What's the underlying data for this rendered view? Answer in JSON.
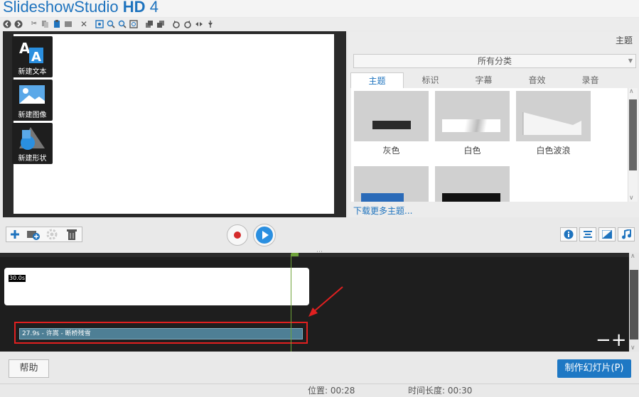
{
  "app": {
    "title_main": "SlideshowStudio",
    "title_suffix": "HD",
    "title_version": "4"
  },
  "toolbar": {
    "icons": [
      "undo-icon",
      "redo-icon",
      "cut-icon",
      "copy-icon",
      "paste-icon",
      "paste-special-icon",
      "delete-icon",
      "zoom-fit-icon",
      "zoom-in-icon",
      "zoom-out-icon",
      "zoom-actual-icon",
      "layer-forward-icon",
      "layer-back-icon",
      "rotate-left-icon",
      "rotate-right-icon",
      "flip-icon",
      "pin-icon"
    ]
  },
  "add_panel": {
    "new_text": "新建文本",
    "new_image": "新建图像",
    "new_shape": "新建形状"
  },
  "right_panel": {
    "header_label": "主题",
    "category": "所有分类",
    "tabs": [
      "主题",
      "标识",
      "字幕",
      "音效",
      "录音"
    ],
    "active_tab": 0,
    "themes": [
      {
        "name": "灰色"
      },
      {
        "name": "白色"
      },
      {
        "name": "白色波浪"
      },
      {
        "name": ""
      },
      {
        "name": ""
      }
    ],
    "more_link": "下载更多主题..."
  },
  "timeline": {
    "slide_duration": "30.0s",
    "audio_clip": "27.9s - 许嵩 - 断桥残雪",
    "zoom_out": "−",
    "zoom_in": "+"
  },
  "bottom": {
    "help": "帮助",
    "make_slideshow": "制作幻灯片(P)"
  },
  "status": {
    "position": "位置: 00:28",
    "duration": "时间长度: 00:30"
  },
  "colors": {
    "accent": "#1e73be",
    "timeline_bg": "#1e1e1e",
    "audio_clip": "#4e7f95",
    "highlight": "#e02020",
    "playhead": "#6fa33a"
  }
}
